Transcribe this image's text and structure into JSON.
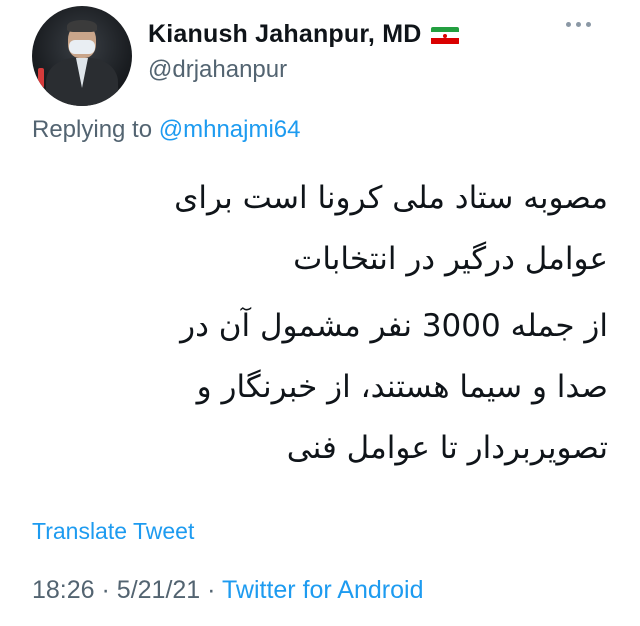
{
  "author": {
    "display_name": "Kianush Jahanpur, MD",
    "handle": "@drjahanpur",
    "flag_icon": "iran-flag-icon",
    "avatar_icon": "profile-avatar"
  },
  "reply": {
    "prefix": "Replying to",
    "mention": "@mhnajmi64"
  },
  "tweet": {
    "paragraph_1": [
      "مصوبه ستاد ملی کرونا است برای",
      "عوامل درگیر در انتخابات"
    ],
    "paragraph_2": [
      "از جمله 3000 نفر مشمول آن در",
      "صدا و سیما هستند، از خبرنگار و",
      "تصویربردار تا عوامل فنی"
    ]
  },
  "translate_label": "Translate Tweet",
  "meta": {
    "time": "18:26",
    "separator": "·",
    "date": "5/21/21",
    "source": "Twitter for Android"
  },
  "colors": {
    "link": "#1d9bf0",
    "muted": "#536471",
    "text": "#0f1419"
  }
}
